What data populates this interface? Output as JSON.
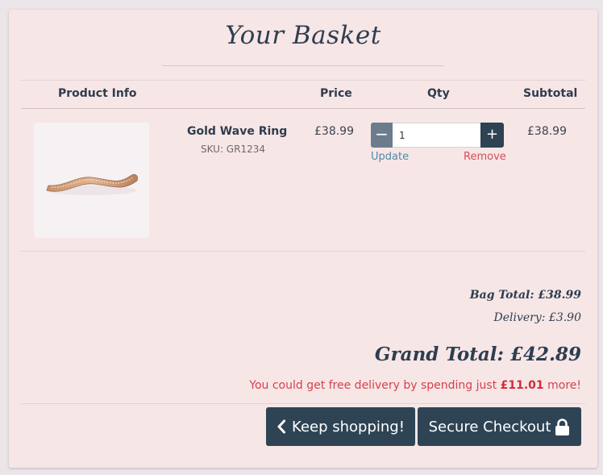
{
  "page": {
    "title": "Your Basket"
  },
  "table": {
    "headers": {
      "product_info": "Product Info",
      "price": "Price",
      "qty": "Qty",
      "subtotal": "Subtotal"
    }
  },
  "item": {
    "name": "Gold Wave Ring",
    "sku": "SKU: GR1234",
    "price": "£38.99",
    "quantity": "1",
    "subtotal": "£38.99",
    "image_icon": "gold-wave-ring-image"
  },
  "controls": {
    "decrease_label": "−",
    "increase_label": "+",
    "update_label": "Update",
    "remove_label": "Remove"
  },
  "summary": {
    "bag_total": "Bag Total: £38.99",
    "delivery": "Delivery: £3.90",
    "grand_total": "Grand Total: £42.89",
    "free_delivery_prefix": "You could get free delivery by spending just ",
    "free_delivery_amount": "£11.01",
    "free_delivery_suffix": " more!"
  },
  "buttons": {
    "keep_shopping": "Keep shopping!",
    "secure_checkout": "Secure Checkout"
  },
  "colors": {
    "card_bg": "#f7e6e6",
    "primary_dark": "#2e4455",
    "link_blue": "#4f8aa9",
    "alert_red": "#d5414c"
  }
}
